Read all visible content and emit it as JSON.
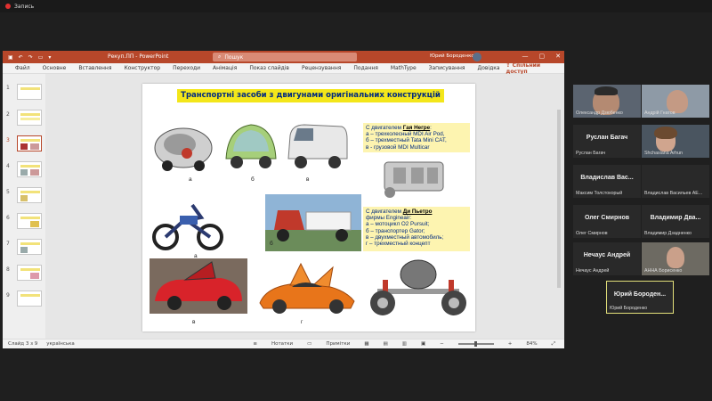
{
  "recording": {
    "label": "Запись"
  },
  "ppt": {
    "doc_title": "Рекуп.ПП - PowerPoint",
    "search_placeholder": "Пошук",
    "user_name": "Юрий Бороденко",
    "qat_icons": [
      "save-icon",
      "undo-icon",
      "redo-icon",
      "present-icon"
    ],
    "ribbon_tabs": [
      "Файл",
      "Основне",
      "Вставлення",
      "Конструктор",
      "Переходи",
      "Анімація",
      "Показ слайдів",
      "Рецензування",
      "Подання",
      "MathType",
      "Записування",
      "Довідка"
    ],
    "share_label": "Спільний доступ",
    "slide_numbers": [
      "1",
      "2",
      "3",
      "4",
      "5",
      "6",
      "7",
      "8",
      "9"
    ],
    "active_slide": 3,
    "status": {
      "slide_of": "Слайд 3 з 9",
      "language": "українська",
      "notes": "Нотатки",
      "comments": "Примітки",
      "zoom": "84%"
    }
  },
  "slide": {
    "title": "Транспортні засоби з двигунами оригінальних конструкцій",
    "note1": {
      "intro": "С двигателем ",
      "name": "Гая Негре",
      "colon": ":",
      "lines": [
        "а – трехколесный MDI Air Pod,",
        "б – трехместный Tata Mini CAT,",
        "в - грузовой MDI Multicar"
      ]
    },
    "note2": {
      "intro": "С двигателем ",
      "name": "Ди Пьетро",
      "line0": "фирмы Engineair:",
      "lines": [
        "а – мотоцикл O2 Pursuit;",
        "б – транспортер Gator;",
        "в – двухместный автомобиль;",
        "г – трехместный концепт"
      ]
    },
    "captions": {
      "a1": "а",
      "b1": "б",
      "c1": "в",
      "a2": "а",
      "b2": "б",
      "c2": "в",
      "d2": "г"
    }
  },
  "participants": [
    {
      "big": "",
      "small": "Олександр Дзюбенко",
      "video": true
    },
    {
      "big": "",
      "small": "Андрій Гнатов",
      "video": true
    },
    {
      "big": "Руслан Багач",
      "small": "Руслан Багач",
      "video": false
    },
    {
      "big": "",
      "small": "Shchasiana Arhun",
      "video": true
    },
    {
      "big": "Владислав Вас...",
      "small": "Максим Толстокорый",
      "video": false
    },
    {
      "big": "",
      "small": "Владислав Васильев АЕ...",
      "video": false
    },
    {
      "big": "Олег Смирнов",
      "small": "Олег Смирнов",
      "video": false
    },
    {
      "big": "Владимир Два...",
      "small": "Владимир Дзадненко",
      "video": false
    },
    {
      "big": "Нечаус Андрей",
      "small": "Нечаус Андрей",
      "video": false
    },
    {
      "big": "",
      "small": "АННА Бориcенко",
      "video": true
    },
    {
      "big": "Юрий Бороден...",
      "small": "Юрий Бороденко",
      "video": false
    }
  ]
}
